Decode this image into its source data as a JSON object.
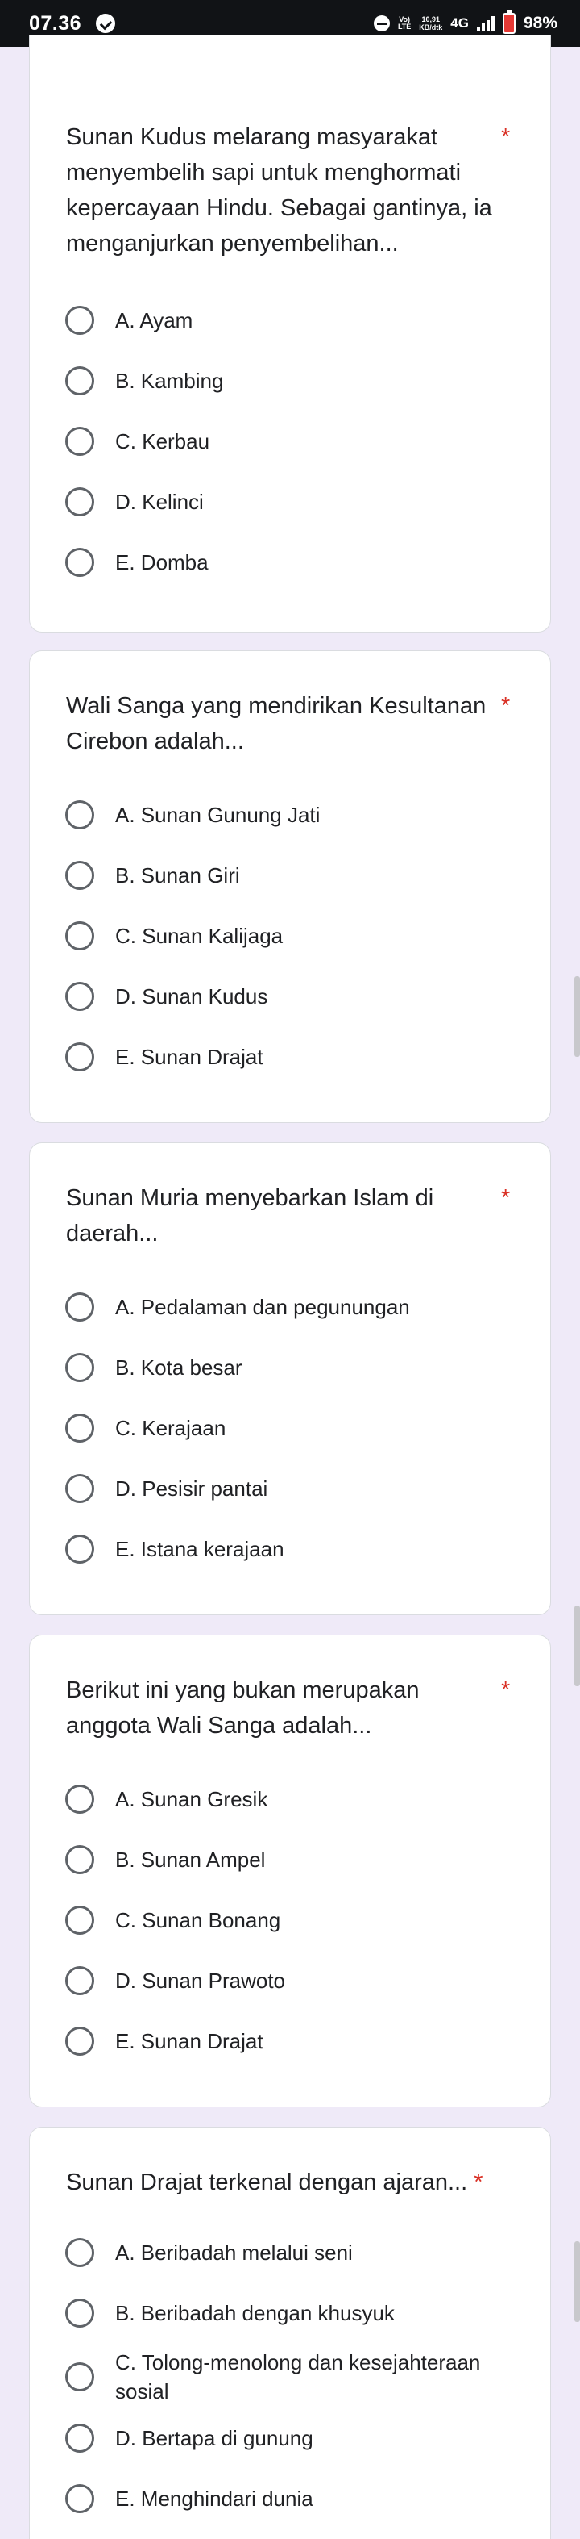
{
  "status_bar": {
    "time": "07.36",
    "volte_top": "Vo)",
    "volte_bottom": "LTE",
    "speed_value": "10,91",
    "speed_unit": "KB/dtk",
    "network": "4G",
    "battery": "98%"
  },
  "questions": [
    {
      "text": "Sunan Kudus melarang masyarakat menyembelih sapi untuk menghormati kepercayaan Hindu. Sebagai gantinya, ia menganjurkan penyembelihan...",
      "required_mark": "*",
      "options": [
        "A. Ayam",
        "B. Kambing",
        "C. Kerbau",
        "D. Kelinci",
        "E. Domba"
      ]
    },
    {
      "text": "Wali Sanga yang mendirikan Kesultanan Cirebon adalah...",
      "required_mark": "*",
      "options": [
        "A. Sunan Gunung Jati",
        "B. Sunan Giri",
        "C. Sunan Kalijaga",
        "D. Sunan Kudus",
        "E. Sunan Drajat"
      ]
    },
    {
      "text": "Sunan Muria menyebarkan Islam di daerah...",
      "required_mark": "*",
      "options": [
        "A. Pedalaman dan pegunungan",
        "B. Kota besar",
        "C. Kerajaan",
        "D. Pesisir pantai",
        "E. Istana kerajaan"
      ]
    },
    {
      "text": "Berikut ini yang bukan merupakan anggota Wali Sanga adalah...",
      "required_mark": "*",
      "options": [
        "A. Sunan Gresik",
        "B. Sunan Ampel",
        "C. Sunan Bonang",
        "D. Sunan Prawoto",
        "E. Sunan Drajat"
      ]
    },
    {
      "text": "Sunan Drajat terkenal dengan ajaran...",
      "required_mark": "*",
      "options": [
        "A. Beribadah melalui seni",
        "B. Beribadah dengan khusyuk",
        "C. Tolong-menolong dan kesejahteraan sosial",
        "D. Bertapa di gunung",
        "E. Menghindari dunia"
      ]
    }
  ]
}
